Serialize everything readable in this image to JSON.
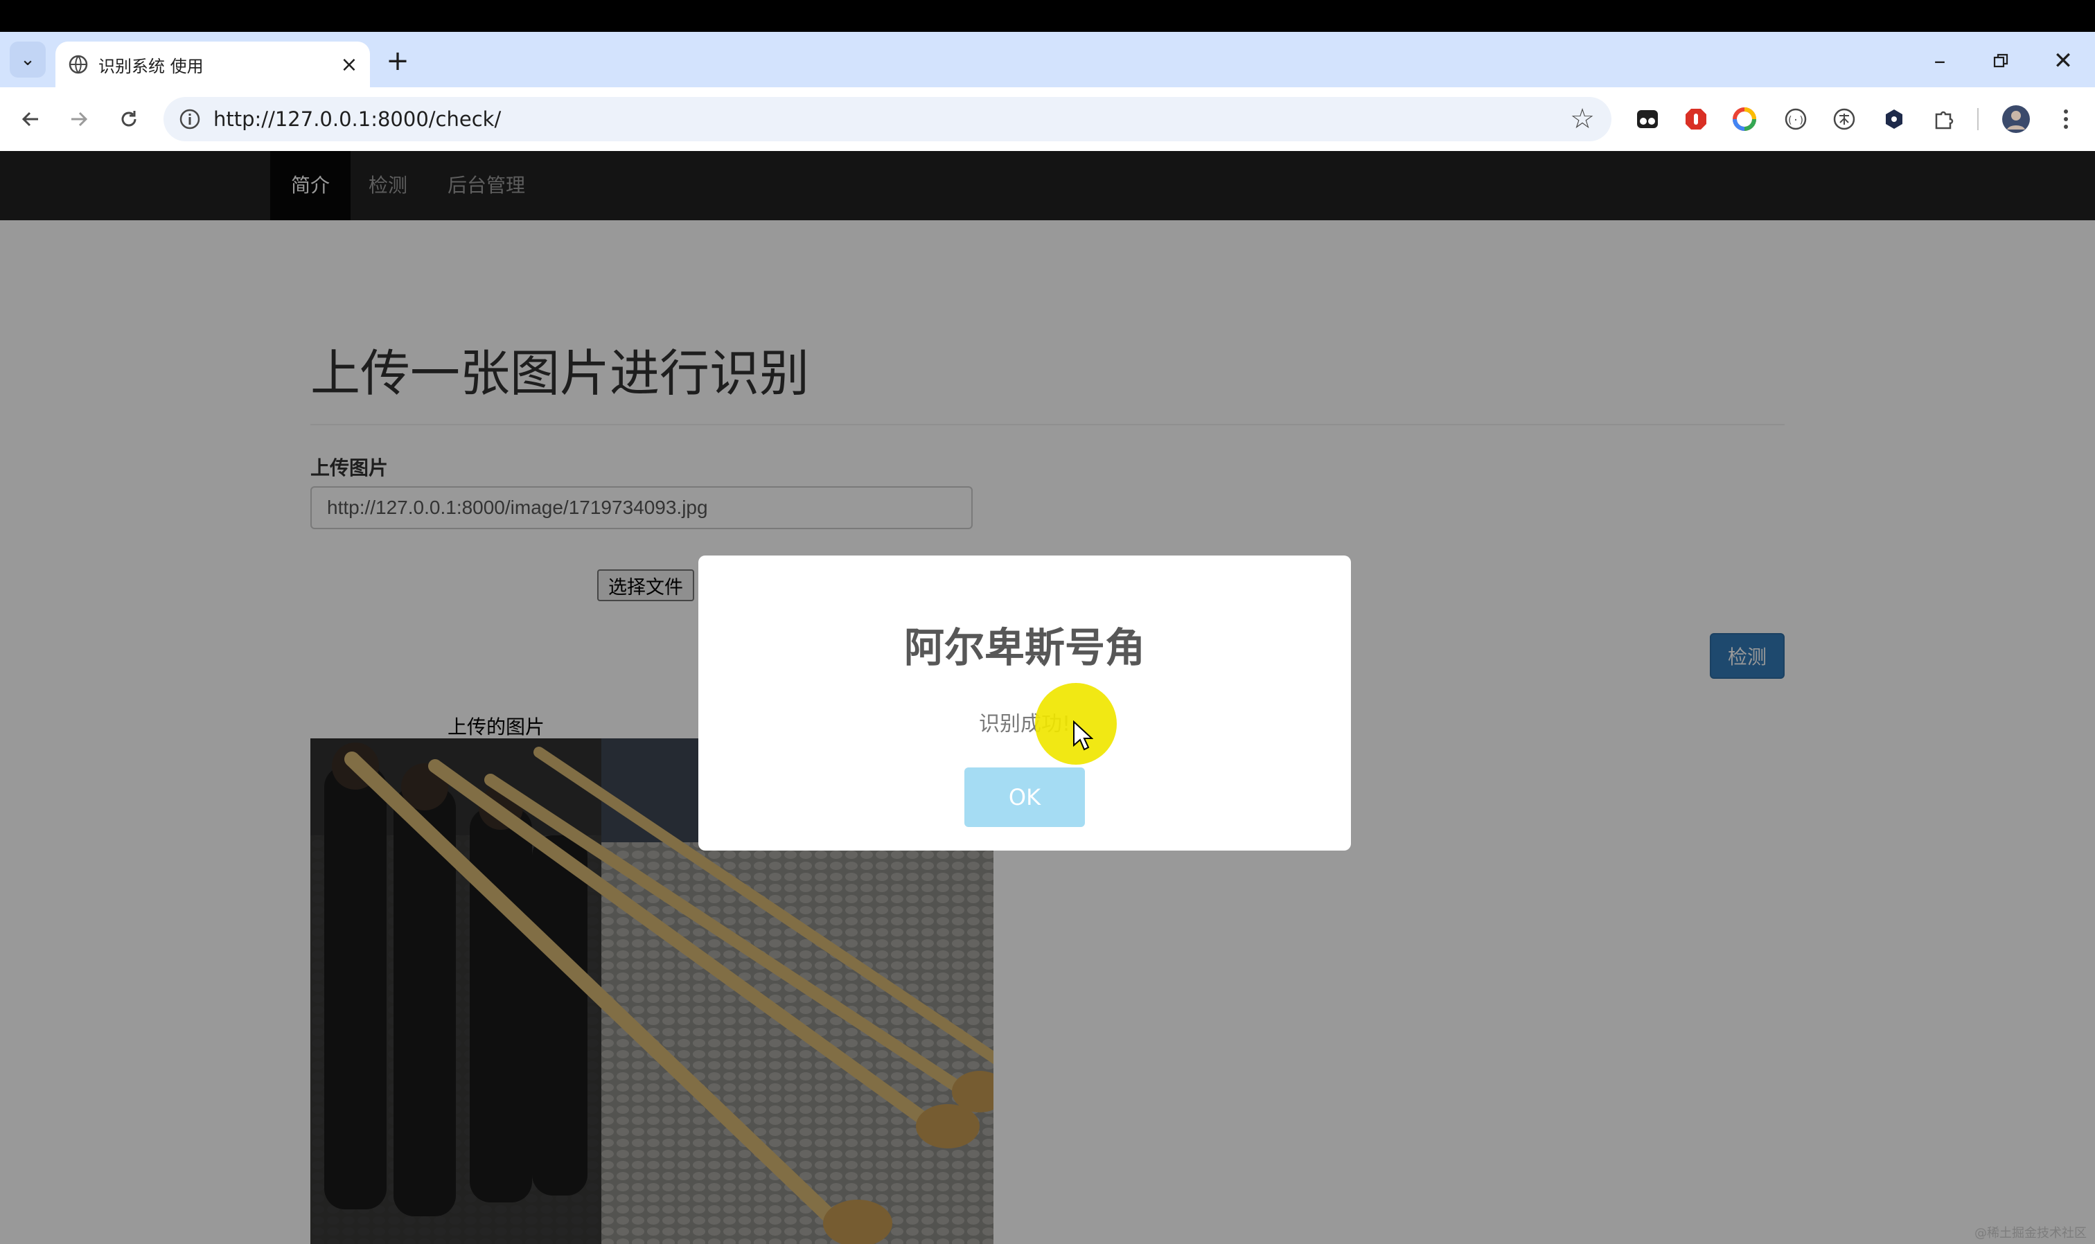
{
  "browser": {
    "tab_title": "识别系统 使用",
    "url": "http://127.0.0.1:8000/check/"
  },
  "site_nav": {
    "items": [
      "简介",
      "检测",
      "后台管理"
    ],
    "active": "简介"
  },
  "main": {
    "heading": "上传一张图片进行识别",
    "upload_label": "上传图片",
    "image_url_value": "http://127.0.0.1:8000/image/1719734093.jpg",
    "choose_file_label": "选择文件",
    "detect_button": "检测",
    "image_caption": "上传的图片"
  },
  "dialog": {
    "title": "阿尔卑斯号角",
    "message": "识别成功!",
    "ok_label": "OK"
  },
  "colors": {
    "nav_bg": "#222222",
    "primary_button": "#337ab7",
    "ok_button": "#a5dcf3",
    "cursor_highlight": "#f0e600"
  },
  "watermark": "@稀土掘金技术社区"
}
